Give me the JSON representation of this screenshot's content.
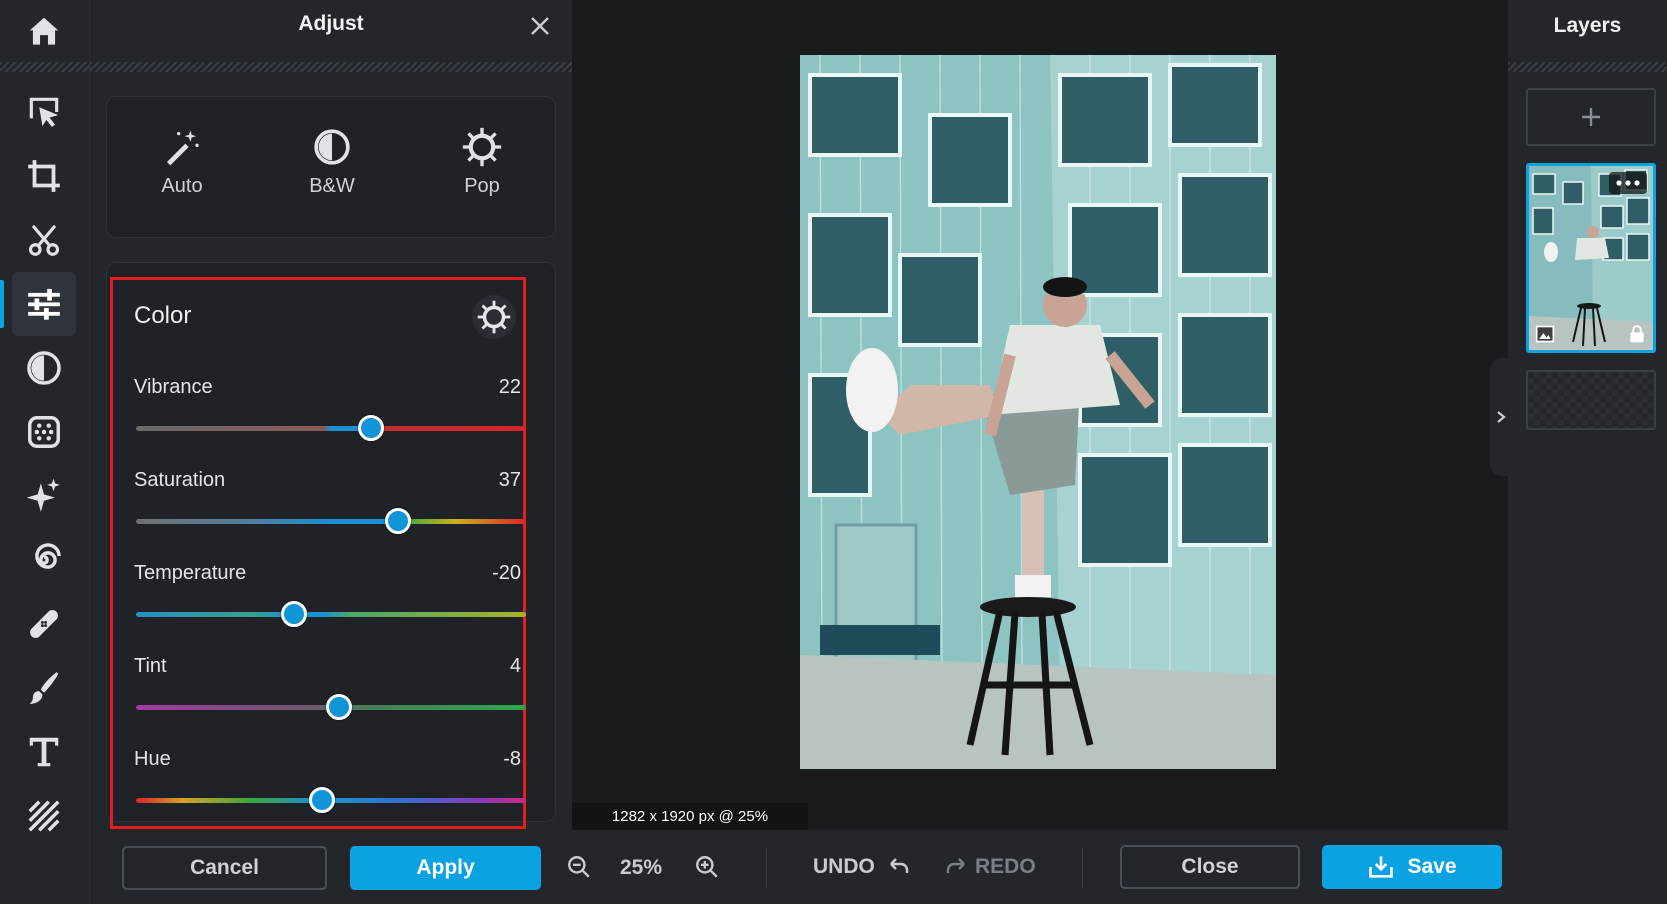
{
  "toolbar": {
    "tools": [
      {
        "name": "home-icon"
      },
      {
        "name": "select-icon"
      },
      {
        "name": "crop-icon"
      },
      {
        "name": "cutout-icon"
      },
      {
        "name": "adjust-icon",
        "active": true
      },
      {
        "name": "filters-icon"
      },
      {
        "name": "effects-icon"
      },
      {
        "name": "sparkle-icon"
      },
      {
        "name": "liquify-icon"
      },
      {
        "name": "retouch-icon"
      },
      {
        "name": "brush-icon"
      },
      {
        "name": "text-icon"
      },
      {
        "name": "texture-icon"
      }
    ]
  },
  "adjust": {
    "title": "Adjust",
    "presets": [
      {
        "label": "Auto",
        "icon": "magic-wand-icon"
      },
      {
        "label": "B&W",
        "icon": "contrast-icon"
      },
      {
        "label": "Pop",
        "icon": "gear-sun-icon"
      }
    ],
    "color": {
      "title": "Color",
      "sliders": [
        {
          "label": "Vibrance",
          "value": "22"
        },
        {
          "label": "Saturation",
          "value": "37"
        },
        {
          "label": "Temperature",
          "value": "-20"
        },
        {
          "label": "Tint",
          "value": "4"
        },
        {
          "label": "Hue",
          "value": "-8"
        }
      ]
    },
    "cancel_label": "Cancel",
    "apply_label": "Apply"
  },
  "canvas": {
    "dimensions": "1282 x 1920 px @ 25%"
  },
  "bottom": {
    "zoom": "25%",
    "undo_label": "UNDO",
    "redo_label": "REDO",
    "close_label": "Close",
    "save_label": "Save"
  },
  "layers": {
    "title": "Layers"
  },
  "colors": {
    "accent": "#0aa2e0",
    "highlight": "#e41e1e"
  }
}
